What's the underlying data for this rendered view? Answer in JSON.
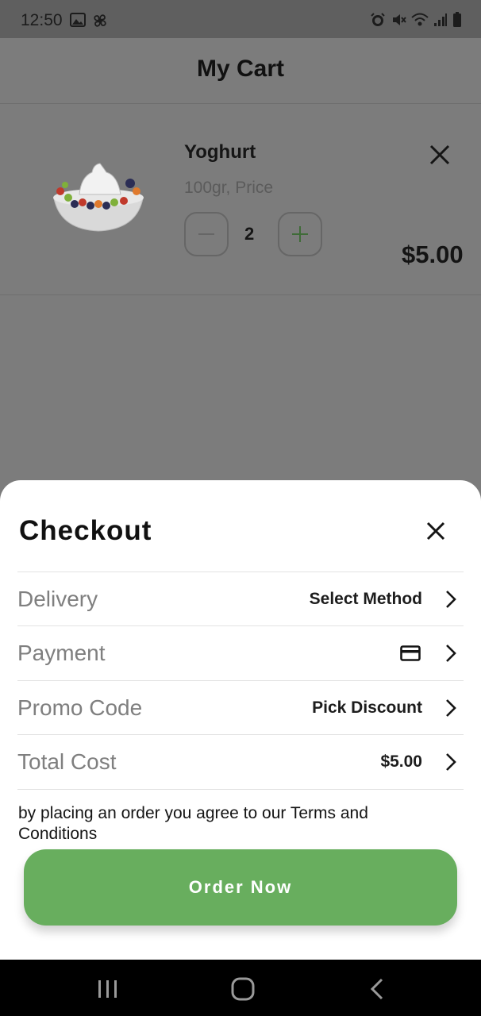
{
  "status_bar": {
    "time": "12:50",
    "left_icons": [
      "image-icon",
      "pinwheel-icon"
    ],
    "right_icons": [
      "alarm-icon",
      "mute-icon",
      "wifi-icon",
      "signal-icon",
      "battery-icon"
    ]
  },
  "header": {
    "title": "My Cart"
  },
  "cart": {
    "items": [
      {
        "name": "Yoghurt",
        "meta": "100gr, Price",
        "quantity": "2",
        "price": "$5.00",
        "image_icon": "yoghurt-bowl-image"
      }
    ]
  },
  "checkout": {
    "title": "Checkout",
    "rows": [
      {
        "label": "Delivery",
        "value": "Select Method"
      },
      {
        "label": "Payment",
        "value_icon": "credit-card-icon"
      },
      {
        "label": "Promo Code",
        "value": "Pick Discount"
      },
      {
        "label": "Total Cost",
        "value": "$5.00"
      }
    ],
    "terms": "by placing an order you agree to our Terms and Conditions",
    "order_button": "Order Now"
  },
  "colors": {
    "accent": "#68ae5e",
    "overlay": "#7c7c7c",
    "nav_bar": "#000000"
  },
  "nav_bar": {
    "buttons": [
      "recent-apps-icon",
      "home-icon",
      "back-icon"
    ]
  }
}
